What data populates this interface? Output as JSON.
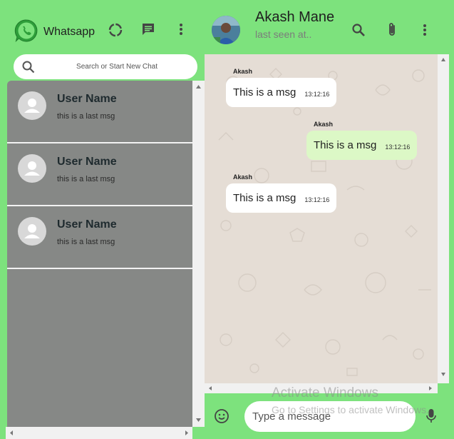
{
  "app": {
    "name": "Whatsapp"
  },
  "sidebar": {
    "search": {
      "placeholder": "Search or Start New Chat",
      "value": ""
    },
    "chats": [
      {
        "name": "User Name",
        "last_message": "this is a last msg"
      },
      {
        "name": "User Name",
        "last_message": "this is a last msg"
      },
      {
        "name": "User Name",
        "last_message": "this is a last msg"
      }
    ]
  },
  "conversation": {
    "contact_name": "Akash Mane",
    "status": "last seen at..",
    "messages": [
      {
        "direction": "in",
        "sender": "Akash",
        "text": "This is a msg",
        "time": "13:12:16"
      },
      {
        "direction": "out",
        "sender": "Akash",
        "text": "This is a msg",
        "time": "13:12:16"
      },
      {
        "direction": "in",
        "sender": "Akash",
        "text": "This is a msg",
        "time": "13:12:16"
      }
    ],
    "composer": {
      "placeholder": "Type a message",
      "value": ""
    }
  },
  "overlay": {
    "activate_title": "Activate Windows",
    "activate_sub": "Go to Settings to activate Windows."
  },
  "icons": [
    "whatsapp-logo",
    "status-icon",
    "new-chat-icon",
    "menu-icon",
    "search-icon",
    "attach-icon",
    "emoji-icon",
    "mic-icon",
    "user-avatar-icon"
  ],
  "colors": {
    "accent": "#7de27d",
    "chat_list_bg": "#868886",
    "chat_bg": "#e5ddd5",
    "bubble_in": "#ffffff",
    "bubble_out": "#dcf8c6"
  }
}
